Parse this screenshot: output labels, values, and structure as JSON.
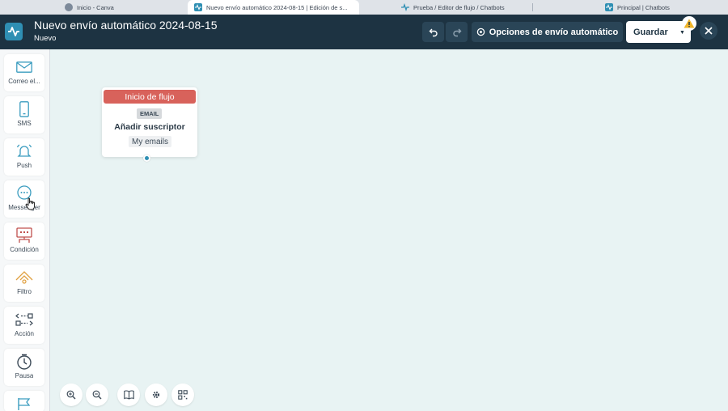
{
  "browser": {
    "tabs": [
      {
        "label": "Inicio - Canva",
        "active": false
      },
      {
        "label": "Nuevo envío automático 2024-08-15 | Edición de s...",
        "active": true
      },
      {
        "label": "Prueba / Editor de flujo / Chatbots",
        "active": false
      },
      {
        "label": "Principal | Chatbots",
        "active": false
      }
    ]
  },
  "header": {
    "title": "Nuevo envío automático 2024-08-15",
    "status": "Nuevo",
    "options_label": "Opciones de envío automático",
    "save_label": "Guardar"
  },
  "sidebar": {
    "items": [
      {
        "label": "Correo el...",
        "icon": "mail-icon"
      },
      {
        "label": "SMS",
        "icon": "phone-icon"
      },
      {
        "label": "Push",
        "icon": "bell-icon"
      },
      {
        "label": "Messenger",
        "icon": "chat-bubble-icon"
      },
      {
        "label": "Condición",
        "icon": "condition-icon"
      },
      {
        "label": "Filtro",
        "icon": "filter-icon"
      },
      {
        "label": "Acción",
        "icon": "action-icon"
      },
      {
        "label": "Pausa",
        "icon": "clock-icon"
      }
    ]
  },
  "flow_node": {
    "header": "Inicio de flujo",
    "tag": "EMAIL",
    "title": "Añadir suscriptor",
    "list": "My emails"
  },
  "colors": {
    "header_bg": "#1d3342",
    "accent": "#2f8fb3",
    "node_header": "#d8625b",
    "canvas_bg": "#e8f3f3"
  }
}
